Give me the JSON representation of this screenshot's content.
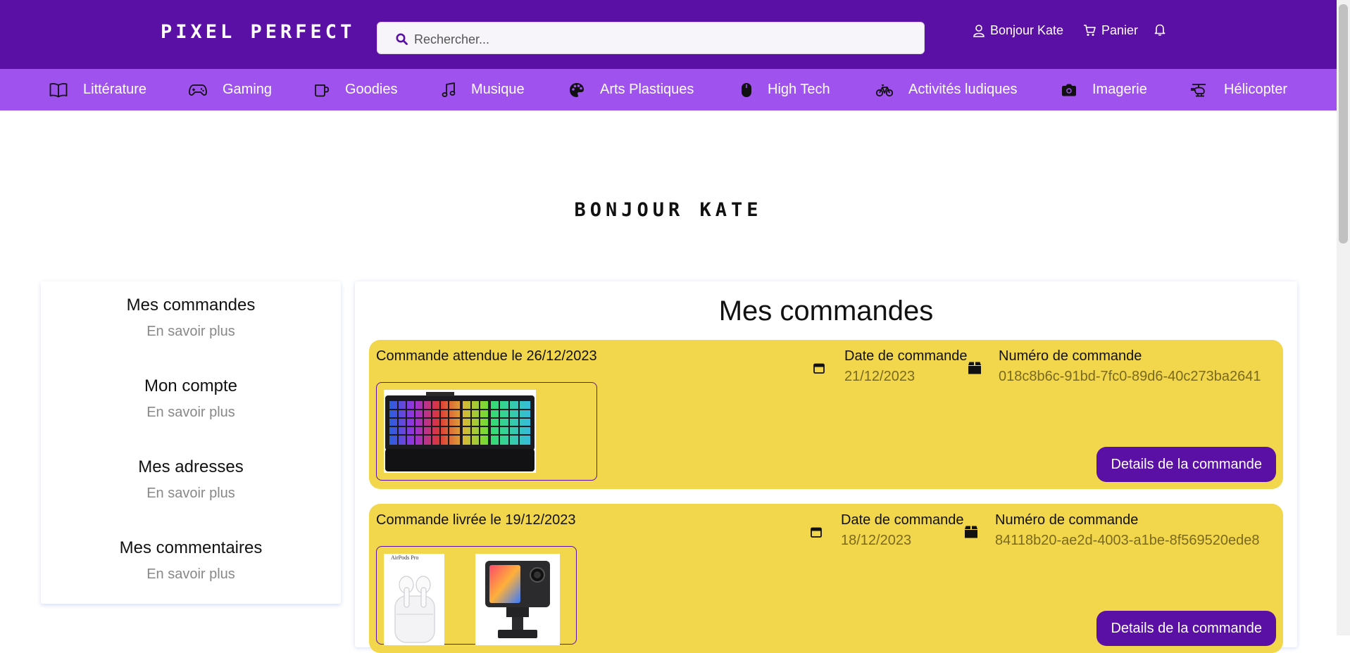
{
  "header": {
    "logo": "PIXEL PERFECT",
    "search_placeholder": "Rechercher...",
    "user_label": "Bonjour Kate",
    "cart_label": "Panier"
  },
  "categories": [
    {
      "label": "Littérature",
      "icon": "book-icon"
    },
    {
      "label": "Gaming",
      "icon": "gamepad-icon"
    },
    {
      "label": "Goodies",
      "icon": "mug-icon"
    },
    {
      "label": "Musique",
      "icon": "music-note-icon"
    },
    {
      "label": "Arts Plastiques",
      "icon": "palette-icon"
    },
    {
      "label": "High Tech",
      "icon": "mouse-icon"
    },
    {
      "label": "Activités ludiques",
      "icon": "bicycle-icon"
    },
    {
      "label": "Imagerie",
      "icon": "camera-icon"
    },
    {
      "label": "Hélicopter",
      "icon": "helicopter-icon"
    }
  ],
  "greeting": "BONJOUR KATE",
  "sidebar": {
    "items": [
      {
        "title": "Mes commandes",
        "link": "En savoir plus"
      },
      {
        "title": "Mon compte",
        "link": "En savoir plus"
      },
      {
        "title": "Mes adresses",
        "link": "En savoir plus"
      },
      {
        "title": "Mes commentaires",
        "link": "En savoir plus"
      }
    ]
  },
  "main": {
    "title": "Mes commandes",
    "orders": [
      {
        "status": "Commande attendue le 26/12/2023",
        "date_label": "Date de commande",
        "date_value": "21/12/2023",
        "number_label": "Numéro de commande",
        "number_value": "018c8b6c-91bd-7fc0-89d6-40c273ba2641",
        "button": "Details de la commande"
      },
      {
        "status": "Commande livrée le 19/12/2023",
        "date_label": "Date de commande",
        "date_value": "18/12/2023",
        "number_label": "Numéro de commande",
        "number_value": "84118b20-ae2d-4003-a1be-8f569520ede8",
        "button": "Details de la commande",
        "thumb_caption": "AirPods Pro"
      }
    ]
  },
  "colors": {
    "primary": "#5b10a5",
    "category_bar": "#a052ee",
    "order_card": "#f2d64b"
  }
}
